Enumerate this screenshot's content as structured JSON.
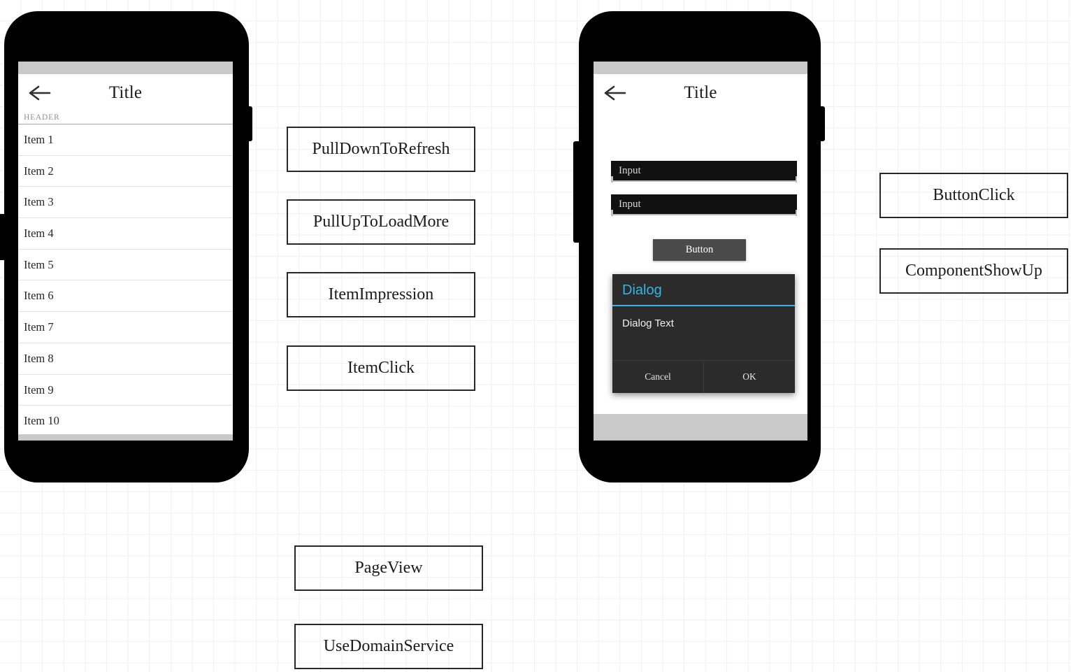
{
  "canvas": {
    "background": "#ffffff",
    "grid_color": "#f0f0f0"
  },
  "phone_list": {
    "title": "Title",
    "back_icon": "back-arrow-icon",
    "section_header": "HEADER",
    "items": [
      "Item 1",
      "Item 2",
      "Item 3",
      "Item 4",
      "Item 5",
      "Item 6",
      "Item 7",
      "Item 8",
      "Item 9",
      "Item 10"
    ]
  },
  "phone_form": {
    "title": "Title",
    "back_icon": "back-arrow-icon",
    "inputs": [
      {
        "value": "Input",
        "placeholder": "Input"
      },
      {
        "value": "Input",
        "placeholder": "Input"
      }
    ],
    "button_label": "Button",
    "dialog": {
      "title": "Dialog",
      "body": "Dialog Text",
      "cancel_label": "Cancel",
      "ok_label": "OK",
      "accent_color": "#33b5e5",
      "surface_color": "#2b2b2b"
    }
  },
  "flow_boxes": {
    "list_column": [
      "PullDownToRefresh",
      "PullUpToLoadMore",
      "ItemImpression",
      "ItemClick"
    ],
    "bottom_column": [
      "PageView",
      "UseDomainService"
    ],
    "right_column": [
      "ButtonClick",
      "ComponentShowUp"
    ]
  }
}
